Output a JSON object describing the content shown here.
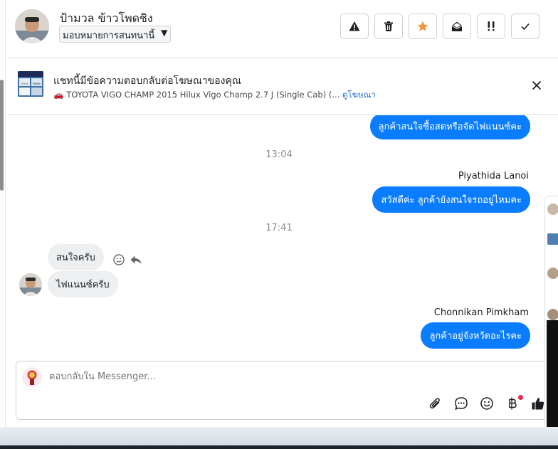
{
  "header": {
    "contact_name": "ป้ามวล ข้าวโพดชิง",
    "assign_label": "มอบหมายการสนทนานี้",
    "actions": [
      {
        "name": "report-spam-button",
        "icon": "alert-triangle-icon"
      },
      {
        "name": "delete-button",
        "icon": "trash-icon"
      },
      {
        "name": "star-button",
        "icon": "star-icon"
      },
      {
        "name": "mark-unread-button",
        "icon": "envelope-open-icon"
      },
      {
        "name": "follow-up-button",
        "icon": "double-exclamation-icon"
      },
      {
        "name": "mark-done-button",
        "icon": "check-icon"
      }
    ]
  },
  "ad": {
    "title": "แชทนี้มีข้อความตอบกลับต่อโฆษณาของคุณ",
    "subtitle": "TOYOTA VIGO CHAMP 2015 Hilux Vigo Champ 2.7 J (Single Cab) (...",
    "link": "ดูโฆษณา",
    "icon": "car-icon"
  },
  "messages": {
    "out_1": "ลูกค้าสนใจซื้อสดหรือจัดไฟแนนซ์คะ",
    "time_1": "13:04",
    "sender_2": "Piyathida Lanoi",
    "out_2": "สวัสดีค่ะ  ลูกค้ายังสนใจรถอยู่ไหมคะ",
    "time_2": "17:41",
    "in_1": "สนใจครับ",
    "in_2": "ไฟแนนซ์ครับ",
    "sender_3": "Chonnikan Pimkham",
    "out_3": "ลูกค้าอยู่จังหวัดอะไรคะ"
  },
  "composer": {
    "placeholder": "ตอบกลับใน Messenger...",
    "tools": [
      "paperclip-icon",
      "saved-reply-icon",
      "emoji-icon",
      "baht-icon",
      "thumbs-up-icon"
    ]
  },
  "colors": {
    "accent": "#0a7cff",
    "star": "#f7923a",
    "link": "#216fdb",
    "notification": "#f02849"
  }
}
